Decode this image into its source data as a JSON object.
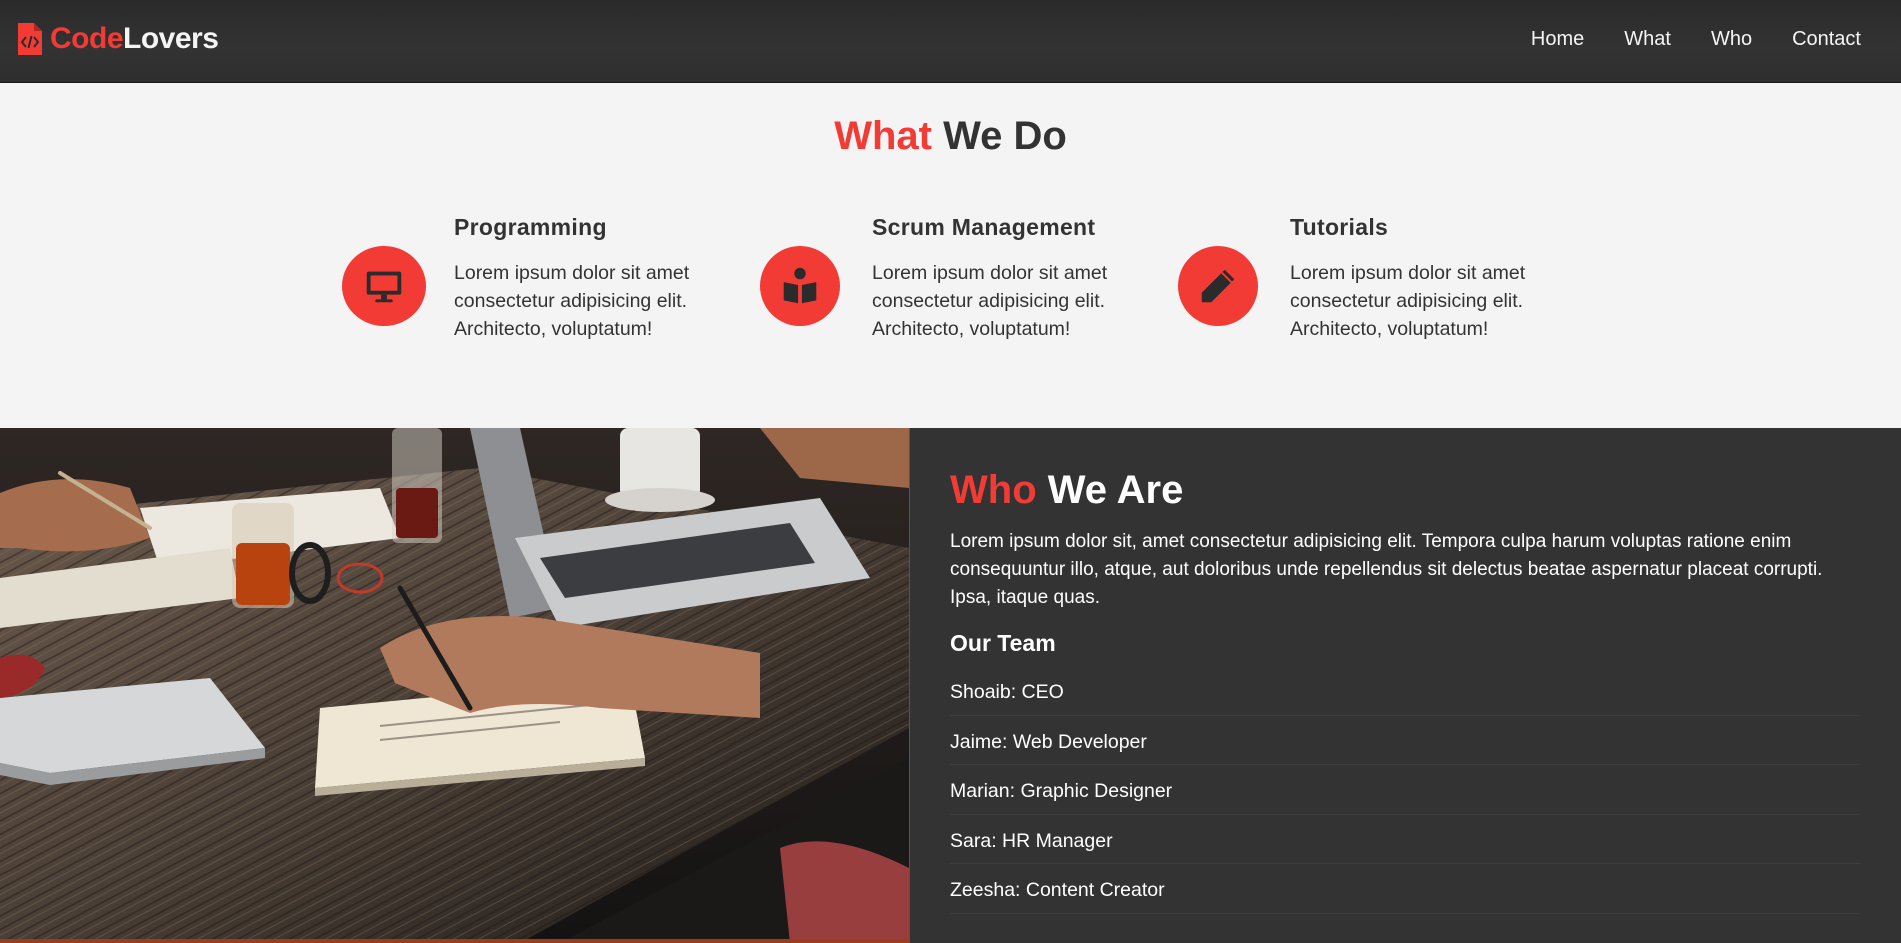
{
  "brand": {
    "name_part1": "Code",
    "name_part2": "Lovers",
    "logo_icon": "file-code-icon"
  },
  "nav": {
    "items": [
      "Home",
      "What",
      "Who",
      "Contact"
    ]
  },
  "what_section": {
    "title_accent": "What",
    "title_rest": "We Do",
    "services": [
      {
        "icon": "desktop-icon",
        "title": "Programming",
        "text": "Lorem ipsum dolor sit amet consectetur adipisicing elit. Architecto, voluptatum!"
      },
      {
        "icon": "book-reader-icon",
        "title": "Scrum Management",
        "text": "Lorem ipsum dolor sit amet consectetur adipisicing elit. Architecto, voluptatum!"
      },
      {
        "icon": "pencil-icon",
        "title": "Tutorials",
        "text": "Lorem ipsum dolor sit amet consectetur adipisicing elit. Architecto, voluptatum!"
      }
    ]
  },
  "who_section": {
    "title_accent": "Who",
    "title_rest": "We Are",
    "text": "Lorem ipsum dolor sit, amet consectetur adipisicing elit. Tempora culpa harum voluptas ratione enim consequuntur illo, atque, aut doloribus unde repellendus sit delectus beatae aspernatur placeat corrupti. Ipsa, itaque quas.",
    "team_title": "Our Team",
    "team": [
      "Shoaib: CEO",
      "Jaime: Web Developer",
      "Marian: Graphic Designer",
      "Sara: HR Manager",
      "Zeesha: Content Creator"
    ]
  },
  "colors": {
    "accent": "#f33b35",
    "dark": "#333333",
    "light": "#f4f4f4"
  }
}
